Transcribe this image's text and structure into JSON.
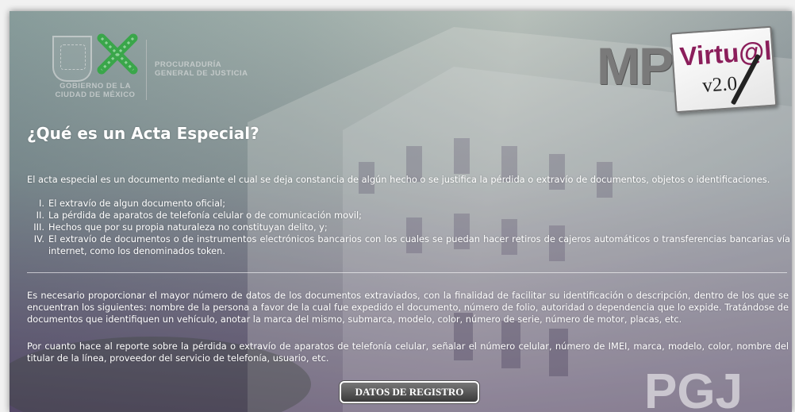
{
  "header": {
    "gobierno_line1": "GOBIERNO DE LA",
    "gobierno_line2": "CIUDAD DE MÉXICO",
    "procuraduria_line1": "PROCURADURÍA",
    "procuraduria_line2": "GENERAL DE JUSTICIA",
    "logo_mp": "MP",
    "logo_virtual": "Virtu@l",
    "logo_version": "v2.0"
  },
  "content": {
    "title": "¿Qué es un Acta Especial?",
    "intro": "El acta especial es un documento mediante el cual se deja constancia de algún hecho o se justifica la pérdida o extravío de documentos, objetos o identificaciones.",
    "items": [
      {
        "num": "I.",
        "text": "El extravío de algun documento oficial;"
      },
      {
        "num": "II.",
        "text": "La pérdida de aparatos de telefonía celular o de comunicación movil;"
      },
      {
        "num": "III.",
        "text": "Hechos que por su propia naturaleza no constituyan delito, y;"
      },
      {
        "num": "IV.",
        "text": "El extravío de documentos o de instrumentos electrónicos bancarios con los cuales se puedan hacer retiros de cajeros automáticos o transferencias bancarias vía internet, como los denominados token."
      }
    ],
    "para1": "Es necesario proporcionar el mayor número de datos de los documentos extraviados, con la finalidad de facilitar su identificación o descripción, dentro de los que se encuentran los siguientes: nombre de la persona a favor de la cual fue expedido el documento, número de folio, autoridad o dependencia que lo expide. Tratándose de documentos que identifiquen un vehículo, anotar la marca del mismo, submarca, modelo, color, número de serie, número de motor, placas, etc.",
    "para2": "Por cuanto hace al reporte sobre la pérdida o extravío de aparatos de telefonía celular, señalar el número celular, número de IMEI, marca, modelo, color, nombre del titular de la línea, proveedor del servicio de telefonía, usuario, etc."
  },
  "building_sign": "PGJ",
  "button": {
    "label": "DATOS DE REGISTRO"
  },
  "colors": {
    "logo_green": "#3aa64a",
    "virtual_magenta": "#8b1e5b",
    "overlay_purple": "#5a4a7a"
  }
}
